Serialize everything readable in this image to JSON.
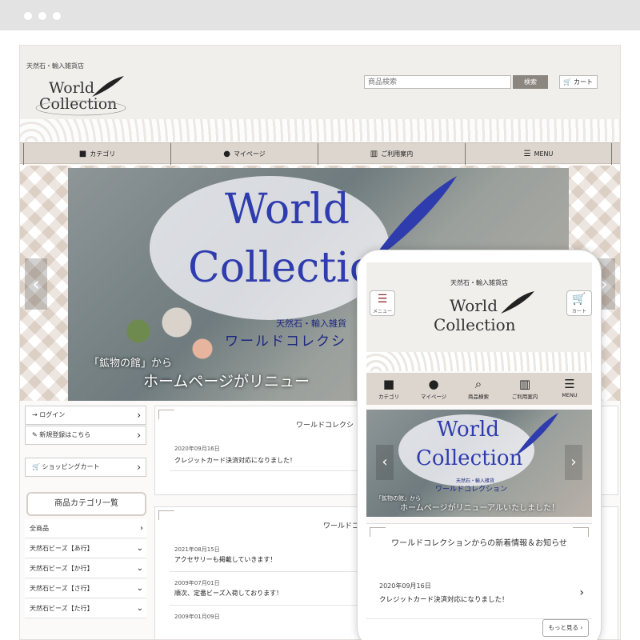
{
  "desktop": {
    "tagline": "天然石・輸入雑貨店",
    "logo": {
      "line1": "World",
      "line2": "Collection"
    },
    "search": {
      "placeholder": "商品検索",
      "button": "検索"
    },
    "cart_label": "カート",
    "nav": [
      {
        "label": "カテゴリ",
        "icon": "folder-icon"
      },
      {
        "label": "マイページ",
        "icon": "user-icon"
      },
      {
        "label": "ご利用案内",
        "icon": "map-icon"
      },
      {
        "label": "MENU",
        "icon": "menu-icon"
      }
    ],
    "hero": {
      "title1": "World",
      "title2": "Collection",
      "sub1": "天然石・輸入雑貨",
      "sub2": "ワールドコレクシ",
      "caption1": "「鉱物の館」から",
      "caption2": "ホームページがリニュー"
    },
    "sidebar": {
      "login": "ログイン",
      "register": "新規登録はこちら",
      "cart": "ショッピングカート",
      "category_title": "商品カテゴリ一覧",
      "categories": [
        "全商品",
        "天然石ビーズ【あ行】",
        "天然石ビーズ【か行】",
        "天然石ビーズ【さ行】",
        "天然石ビーズ【た行】"
      ]
    },
    "news1": {
      "title": "ワールドコレクシ",
      "items": [
        {
          "date": "2020年09月16日",
          "text": "クレジットカード決済対応になりました！"
        }
      ]
    },
    "news2": {
      "title": "ワールドコ",
      "items": [
        {
          "date": "2021年08月15日",
          "text": "アクセサリーも掲載していきます！"
        },
        {
          "date": "2009年07月01日",
          "text": "順次、定番ビーズ入荷しております！"
        },
        {
          "date": "2009年01月09日",
          "text": ""
        }
      ]
    }
  },
  "mobile": {
    "tagline": "天然石・輸入雑貨店",
    "menu_label": "メニュー",
    "cart_label": "カート",
    "logo": {
      "line1": "World",
      "line2": "Collection"
    },
    "nav": [
      {
        "label": "カテゴリ",
        "icon": "folder-icon"
      },
      {
        "label": "マイページ",
        "icon": "user-icon"
      },
      {
        "label": "商品検索",
        "icon": "search-icon"
      },
      {
        "label": "ご利用案内",
        "icon": "map-icon"
      },
      {
        "label": "MENU",
        "icon": "menu-icon"
      }
    ],
    "hero": {
      "title1": "World",
      "title2": "Collection",
      "sub1": "天然石・輸入雑貨",
      "sub2": "ワールドコレクション",
      "caption1": "「鉱物の館」から",
      "caption2": "ホームページがリニューアルいたしました！"
    },
    "news": {
      "title": "ワールドコレクションからの新着情報＆お知らせ",
      "date": "2020年09月16日",
      "text": "クレジットカード決済対応になりました！",
      "more": "もっと見る"
    }
  },
  "colors": {
    "accent": "#2f3cae",
    "nav_bg": "#ddd6cf",
    "cart_icon": "#8b2f2f",
    "search_button": "#8b867f"
  }
}
